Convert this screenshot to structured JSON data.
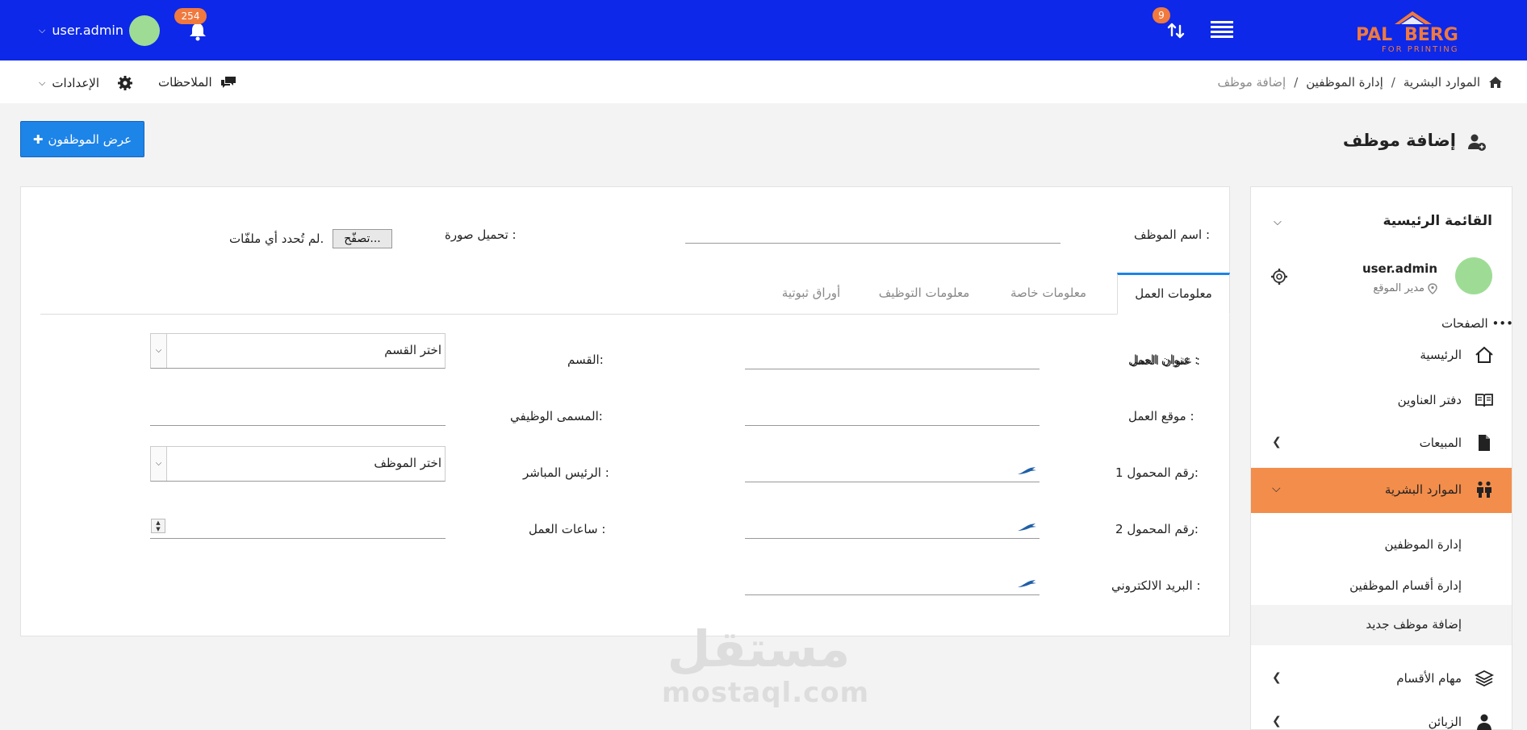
{
  "topbar": {
    "logo_main_left": "PAL",
    "logo_main_right": "BERG",
    "logo_sub": "FOR PRINTING",
    "sync_badge": "9",
    "bell_badge": "254",
    "username": "user.admin"
  },
  "subbar": {
    "breadcrumb": [
      "الموارد البشرية",
      "إدارة الموظفين",
      "إضافة موظف"
    ],
    "separator": "/",
    "notes_label": "الملاحظات",
    "settings_label": "الإعدادات"
  },
  "header": {
    "title": "إضافة موظف",
    "show_button": "عرض الموظفون"
  },
  "sidebar": {
    "title": "القائمة الرئيسية",
    "username": "user.admin",
    "role": "مدير الموقع",
    "pages_label": "الصفحات •••",
    "items": [
      {
        "label": "الرئيسية",
        "icon": "home-outline-icon"
      },
      {
        "label": "دفتر العناوين",
        "icon": "book-open-icon"
      },
      {
        "label": "المبيعات",
        "icon": "file-icon"
      },
      {
        "label": "الموارد البشرية",
        "icon": "people-icon"
      }
    ],
    "subitems": [
      {
        "label": "إدارة الموظفين"
      },
      {
        "label": "إدارة أقسام الموظفين"
      },
      {
        "label": "إضافة موظف جديد"
      }
    ],
    "bottom_items": [
      {
        "label": "مهام الأقسام",
        "icon": "layers-icon"
      },
      {
        "label": "الزبائن",
        "icon": "person-icon"
      }
    ]
  },
  "form": {
    "name_label": "اسم الموظف :",
    "name_value": "",
    "photo_label": "تحميل صورة :",
    "file_button": "تصفّح...",
    "file_status": "لم تُحدد أي ملفّات."
  },
  "tabs": [
    {
      "label": "معلومات العمل",
      "active": true
    },
    {
      "label": "معلومات خاصة",
      "active": false
    },
    {
      "label": "معلومات التوظيف",
      "active": false
    },
    {
      "label": "أوراق ثبوتية",
      "active": false
    }
  ],
  "fields": {
    "work_address": "عنوان العمل :",
    "work_location": "موقع العمل :",
    "mobile1": "رقم المحمول 1:",
    "mobile2": "رقم المحمول 2:",
    "email": "البريد الالكتروني :",
    "department": "القسم:",
    "department_select": "اختر القسم",
    "job_title": "المسمى الوظيفي:",
    "manager": "الرئيس المباشر :",
    "manager_select": "اختر الموظف",
    "work_hours": "ساعات العمل :"
  },
  "watermark": {
    "arabic": "مستقل",
    "latin": "mostaql.com"
  },
  "colors": {
    "topbar": "#0d28e8",
    "accent_button": "#1d84e8",
    "active_sidebar": "#f38d4b",
    "badge": "#f0793e",
    "avatar": "#9edc95"
  }
}
